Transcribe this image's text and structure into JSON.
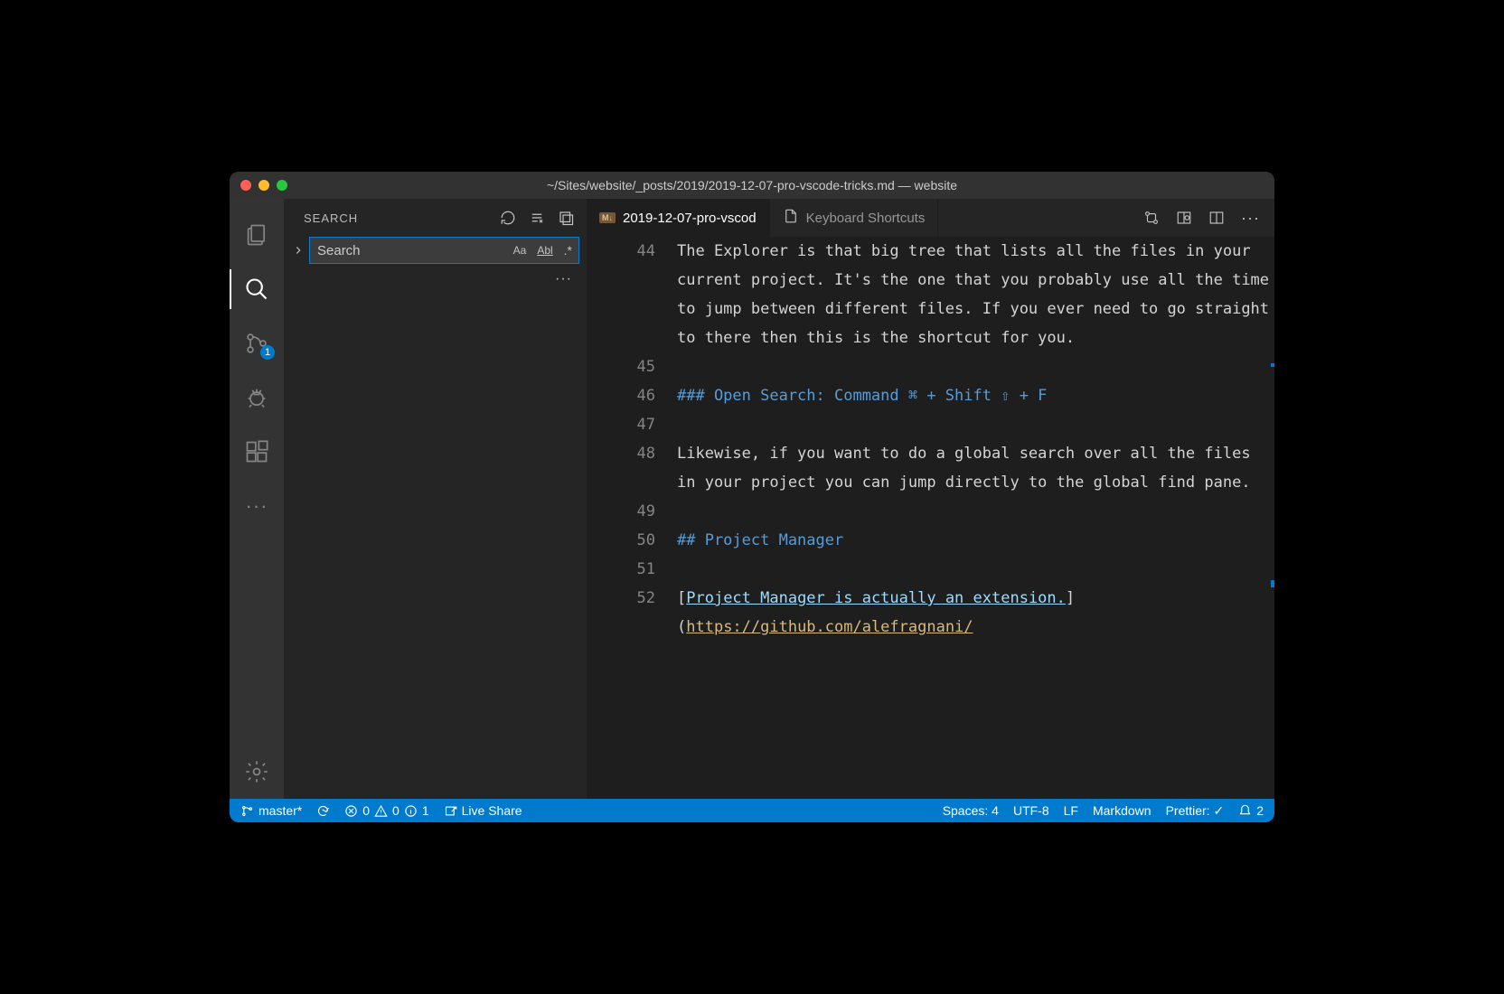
{
  "window": {
    "title": "~/Sites/website/_posts/2019/2019-12-07-pro-vscode-tricks.md — website"
  },
  "activitybar": {
    "scm_badge": "1"
  },
  "sidebar": {
    "title": "SEARCH",
    "search_value": "Search",
    "search_placeholder": "Search",
    "case_label": "Aa",
    "word_label": "Abl",
    "regex_label": ".*"
  },
  "tabs": [
    {
      "label": "2019-12-07-pro-vscod",
      "icon": "md",
      "active": true
    },
    {
      "label": "Keyboard Shortcuts",
      "icon": "file",
      "active": false
    }
  ],
  "editor": {
    "lines": [
      {
        "n": 44,
        "text": "The Explorer is that big tree that lists all the files in your current project. It's the one that you probably use all the time to jump between different files. If you ever need to go straight to there then this is the shortcut for you."
      },
      {
        "n": 45,
        "text": ""
      },
      {
        "n": 46,
        "head": "### ",
        "text": "Open Search: Command ⌘ + Shift ⇧ + F"
      },
      {
        "n": 47,
        "text": ""
      },
      {
        "n": 48,
        "text": "Likewise, if you want to do a global search over all the files in your project you can jump directly to the global find pane."
      },
      {
        "n": 49,
        "text": ""
      },
      {
        "n": 50,
        "head": "## ",
        "text": "Project Manager"
      },
      {
        "n": 51,
        "text": ""
      },
      {
        "n": 52,
        "link_text": "Project Manager is actually an extension.",
        "link_url": "https://github.com/alefragnani/"
      }
    ]
  },
  "statusbar": {
    "branch": "master*",
    "errors": "0",
    "warnings": "0",
    "info": "1",
    "liveshare": "Live Share",
    "spaces": "Spaces: 4",
    "encoding": "UTF-8",
    "eol": "LF",
    "lang": "Markdown",
    "prettier": "Prettier: ✓",
    "notif": "2"
  }
}
